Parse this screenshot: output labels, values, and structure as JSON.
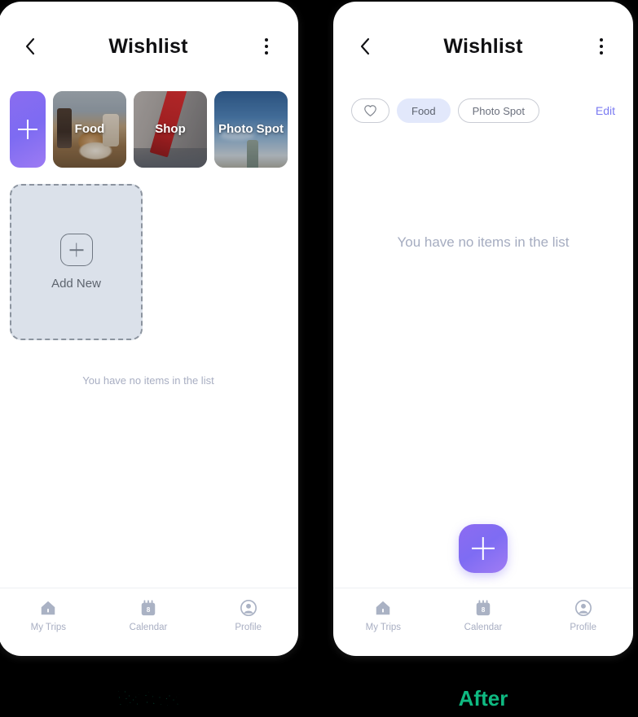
{
  "captions": {
    "before": "Before",
    "after": "After",
    "accent_color": "#0fb981"
  },
  "before_screen": {
    "appbar": {
      "back_icon": "chevron-left-icon",
      "title": "Wishlist",
      "menu_icon": "kebab-menu-icon"
    },
    "categories": {
      "add_button_icon": "plus-icon",
      "items": [
        {
          "label": "Food",
          "photo": "food-photo"
        },
        {
          "label": "Shop",
          "photo": "shop-photo"
        },
        {
          "label": "Photo Spot",
          "photo": "photo-spot-photo"
        }
      ]
    },
    "add_new_card": {
      "icon": "plus-in-square-icon",
      "label": "Add New"
    },
    "empty_text": "You have no items in the list",
    "bottom_nav": [
      {
        "icon": "home-icon",
        "label": "My Trips"
      },
      {
        "icon": "calendar-icon",
        "label": "Calendar",
        "badge": "8"
      },
      {
        "icon": "profile-icon",
        "label": "Profile"
      }
    ]
  },
  "after_screen": {
    "appbar": {
      "back_icon": "chevron-left-icon",
      "title": "Wishlist",
      "menu_icon": "kebab-menu-icon"
    },
    "filters": {
      "heart_chip_icon": "heart-icon",
      "chips": [
        {
          "label": "Food",
          "selected": true
        },
        {
          "label": "Photo Spot",
          "selected": false
        }
      ],
      "selected_chip_color": "#e2e8fb",
      "edit_label": "Edit",
      "edit_color": "#7b7bf2"
    },
    "empty_text": "You have no items in the list",
    "fab": {
      "icon": "plus-icon",
      "color_start": "#8d6bf1",
      "color_end": "#a07cf3"
    },
    "bottom_nav": [
      {
        "icon": "home-icon",
        "label": "My Trips"
      },
      {
        "icon": "calendar-icon",
        "label": "Calendar",
        "badge": "8"
      },
      {
        "icon": "profile-icon",
        "label": "Profile"
      }
    ]
  }
}
